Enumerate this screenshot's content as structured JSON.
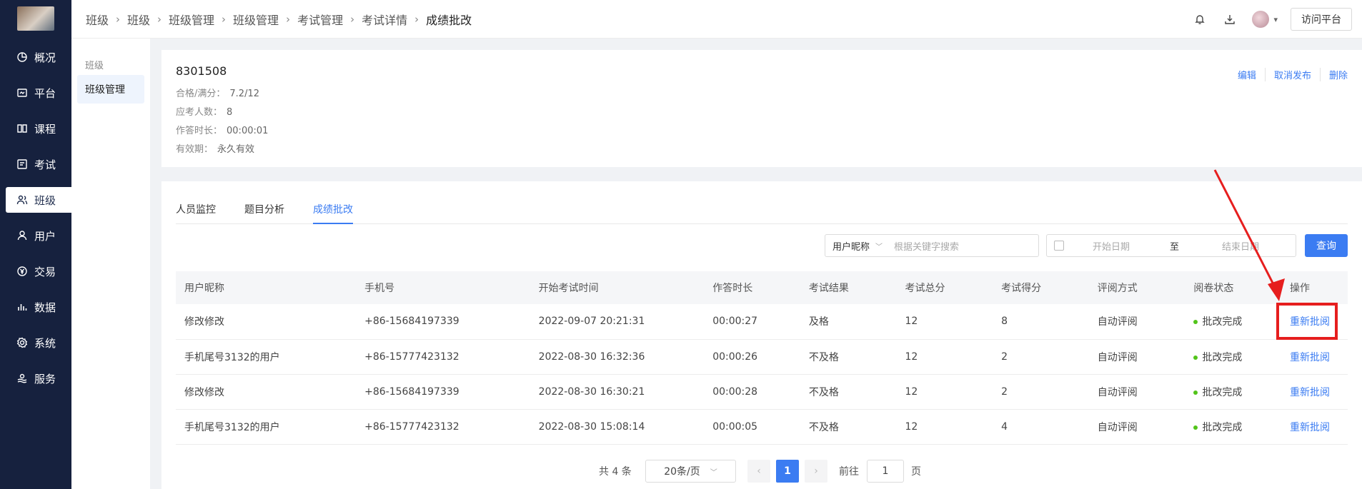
{
  "sidebar": {
    "items": [
      {
        "label": "概况",
        "icon": "pie-chart-icon"
      },
      {
        "label": "平台",
        "icon": "platform-icon"
      },
      {
        "label": "课程",
        "icon": "book-icon"
      },
      {
        "label": "考试",
        "icon": "exam-icon"
      },
      {
        "label": "班级",
        "icon": "class-group-icon",
        "active": true
      },
      {
        "label": "用户",
        "icon": "user-icon"
      },
      {
        "label": "交易",
        "icon": "yen-icon"
      },
      {
        "label": "数据",
        "icon": "bar-chart-icon"
      },
      {
        "label": "系统",
        "icon": "gear-icon"
      },
      {
        "label": "服务",
        "icon": "service-icon"
      }
    ]
  },
  "subnav": {
    "group_title": "班级",
    "item": "班级管理"
  },
  "breadcrumb": [
    "班级",
    "班级",
    "班级管理",
    "班级管理",
    "考试管理",
    "考试详情",
    "成绩批改"
  ],
  "topbar": {
    "visit_button": "访问平台"
  },
  "exam": {
    "title": "8301508",
    "pass_label": "合格/满分：",
    "pass_value": "7.2/12",
    "count_label": "应考人数：",
    "count_value": "8",
    "duration_label": "作答时长：",
    "duration_value": "00:00:01",
    "validity_label": "有效期：",
    "validity_value": "永久有效",
    "actions": {
      "edit": "编辑",
      "unpublish": "取消发布",
      "delete": "删除"
    }
  },
  "tabs": [
    "人员监控",
    "题目分析",
    "成绩批改"
  ],
  "filters": {
    "field_select": "用户昵称",
    "keyword_placeholder": "根据关键字搜索",
    "start_placeholder": "开始日期",
    "to_label": "至",
    "end_placeholder": "结束日期",
    "query_button": "查询"
  },
  "table": {
    "headers": [
      "用户昵称",
      "手机号",
      "开始考试时间",
      "作答时长",
      "考试结果",
      "考试总分",
      "考试得分",
      "评阅方式",
      "阅卷状态",
      "操作"
    ],
    "rows": [
      [
        "修改修改",
        "+86-15684197339",
        "2022-09-07 20:21:31",
        "00:00:27",
        "及格",
        "12",
        "8",
        "自动评阅",
        "批改完成",
        "重新批阅"
      ],
      [
        "手机尾号3132的用户",
        "+86-15777423132",
        "2022-08-30 16:32:36",
        "00:00:26",
        "不及格",
        "12",
        "2",
        "自动评阅",
        "批改完成",
        "重新批阅"
      ],
      [
        "修改修改",
        "+86-15684197339",
        "2022-08-30 16:30:21",
        "00:00:28",
        "不及格",
        "12",
        "2",
        "自动评阅",
        "批改完成",
        "重新批阅"
      ],
      [
        "手机尾号3132的用户",
        "+86-15777423132",
        "2022-08-30 15:08:14",
        "00:00:05",
        "不及格",
        "12",
        "4",
        "自动评阅",
        "批改完成",
        "重新批阅"
      ]
    ]
  },
  "pagination": {
    "total": "共 4 条",
    "page_size": "20条/页",
    "current": "1",
    "goto_label": "前往",
    "goto_value": "1",
    "page_unit": "页"
  },
  "colors": {
    "sidebar_bg": "#16213e",
    "accent": "#3b7cf2",
    "highlight": "#e61e1e",
    "status_ok": "#52c41a"
  }
}
